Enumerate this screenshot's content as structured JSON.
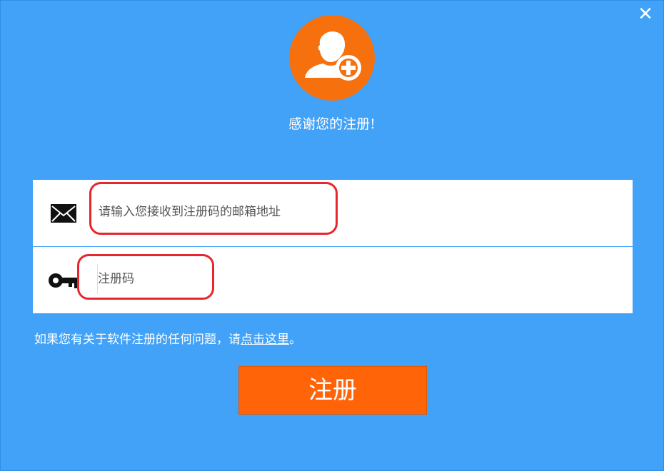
{
  "dialog": {
    "close_label": "✕",
    "thanks_text": "感谢您的注册!"
  },
  "form": {
    "email_placeholder": "请输入您接收到注册码的邮箱地址",
    "code_placeholder": "注册码"
  },
  "help": {
    "prefix": "如果您有关于软件注册的任何问题，请",
    "link_text": "点击这里",
    "suffix": "。"
  },
  "actions": {
    "submit_label": "注册"
  },
  "colors": {
    "background": "#42a2f7",
    "accent": "#ff6409",
    "annotation": "#e8262d"
  }
}
